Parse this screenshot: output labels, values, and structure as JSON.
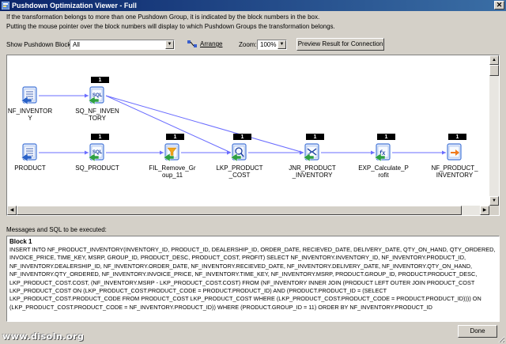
{
  "window": {
    "title": "Pushdown Optimization Viewer - Full",
    "close_glyph": "✕"
  },
  "info": {
    "line1": "If the transformation belongs to more than one Pushdown Group, it is indicated by the block numbers  in the box.",
    "line2": "Putting the mouse pointer over the block numbers will display to which Pushdown Groups the transformation belongs."
  },
  "toolbar": {
    "show_block_label": "Show Pushdown Block:",
    "show_block_value": "All",
    "arrange_label": "Arrange",
    "zoom_label": "Zoom:",
    "zoom_value": "100%",
    "preview_label": "Preview Result for Connection"
  },
  "mapping": {
    "nodes": [
      {
        "id": "nf_inventory",
        "label1": "NF_INVENTOR",
        "label2": "Y",
        "kind": "source",
        "badge": ""
      },
      {
        "id": "sq_nf_inventory",
        "label1": "SQ_NF_INVEN",
        "label2": "TORY",
        "kind": "sq",
        "badge": "1"
      },
      {
        "id": "product",
        "label1": "PRODUCT",
        "label2": "",
        "kind": "source",
        "badge": ""
      },
      {
        "id": "sq_product",
        "label1": "SQ_PRODUCT",
        "label2": "",
        "kind": "sq",
        "badge": "1"
      },
      {
        "id": "fil_remove_group",
        "label1": "FIL_Remove_Gr",
        "label2": "oup_11",
        "kind": "filter",
        "badge": "1"
      },
      {
        "id": "lkp_product_cost",
        "label1": "LKP_PRODUCT",
        "label2": "_COST",
        "kind": "lookup",
        "badge": "1"
      },
      {
        "id": "jnr_product_inventory",
        "label1": "JNR_PRODUCT",
        "label2": "_INVENTORY",
        "kind": "joiner",
        "badge": "1"
      },
      {
        "id": "exp_calculate_profit",
        "label1": "EXP_Calculate_P",
        "label2": "rofit",
        "kind": "expression",
        "badge": "1"
      },
      {
        "id": "nf_product_inventory",
        "label1": "NF_PRODUCT_",
        "label2": "INVENTORY",
        "kind": "target",
        "badge": "1"
      }
    ]
  },
  "sql_section": {
    "label": "Messages and SQL to be executed:",
    "block_title": "Block 1",
    "sql_text": "INSERT INTO NF_PRODUCT_INVENTORY(INVENTORY_ID, PRODUCT_ID, DEALERSHIP_ID, ORDER_DATE, RECIEVED_DATE, DELIVERY_DATE, QTY_ON_HAND, QTY_ORDERED, INVOICE_PRICE, TIME_KEY, MSRP, GROUP_ID, PRODUCT_DESC, PRODUCT_COST, PROFIT) SELECT NF_INVENTORY.INVENTORY_ID, NF_INVENTORY.PRODUCT_ID, NF_INVENTORY.DEALERSHIP_ID, NF_INVENTORY.ORDER_DATE, NF_INVENTORY.RECIEVED_DATE, NF_INVENTORY.DELIVERY_DATE, NF_INVENTORY.QTY_ON_HAND, NF_INVENTORY.QTY_ORDERED, NF_INVENTORY.INVOICE_PRICE, NF_INVENTORY.TIME_KEY, NF_INVENTORY.MSRP, PRODUCT.GROUP_ID, PRODUCT.PRODUCT_DESC, LKP_PRODUCT_COST.COST, (NF_INVENTORY.MSRP - LKP_PRODUCT_COST.COST) FROM (NF_INVENTORY INNER JOIN (PRODUCT LEFT OUTER JOIN PRODUCT_COST LKP_PRODUCT_COST ON (LKP_PRODUCT_COST.PRODUCT_CODE = PRODUCT.PRODUCT_ID) AND (PRODUCT.PRODUCT_ID = (SELECT LKP_PRODUCT_COST.PRODUCT_CODE FROM PRODUCT_COST LKP_PRODUCT_COST WHERE (LKP_PRODUCT_COST.PRODUCT_CODE = PRODUCT.PRODUCT_ID)))) ON (LKP_PRODUCT_COST.PRODUCT_CODE = NF_INVENTORY.PRODUCT_ID)) WHERE (PRODUCT.GROUP_ID = 11) ORDER BY NF_INVENTORY.PRODUCT_ID"
  },
  "footer": {
    "done_label": "Done",
    "watermark": "www.disoln.org"
  },
  "colors": {
    "title_start": "#0a246a",
    "title_end": "#3a6ea5",
    "edge": "#6a6cff",
    "badge": "#000000",
    "arrow_green": "#2ea043"
  }
}
